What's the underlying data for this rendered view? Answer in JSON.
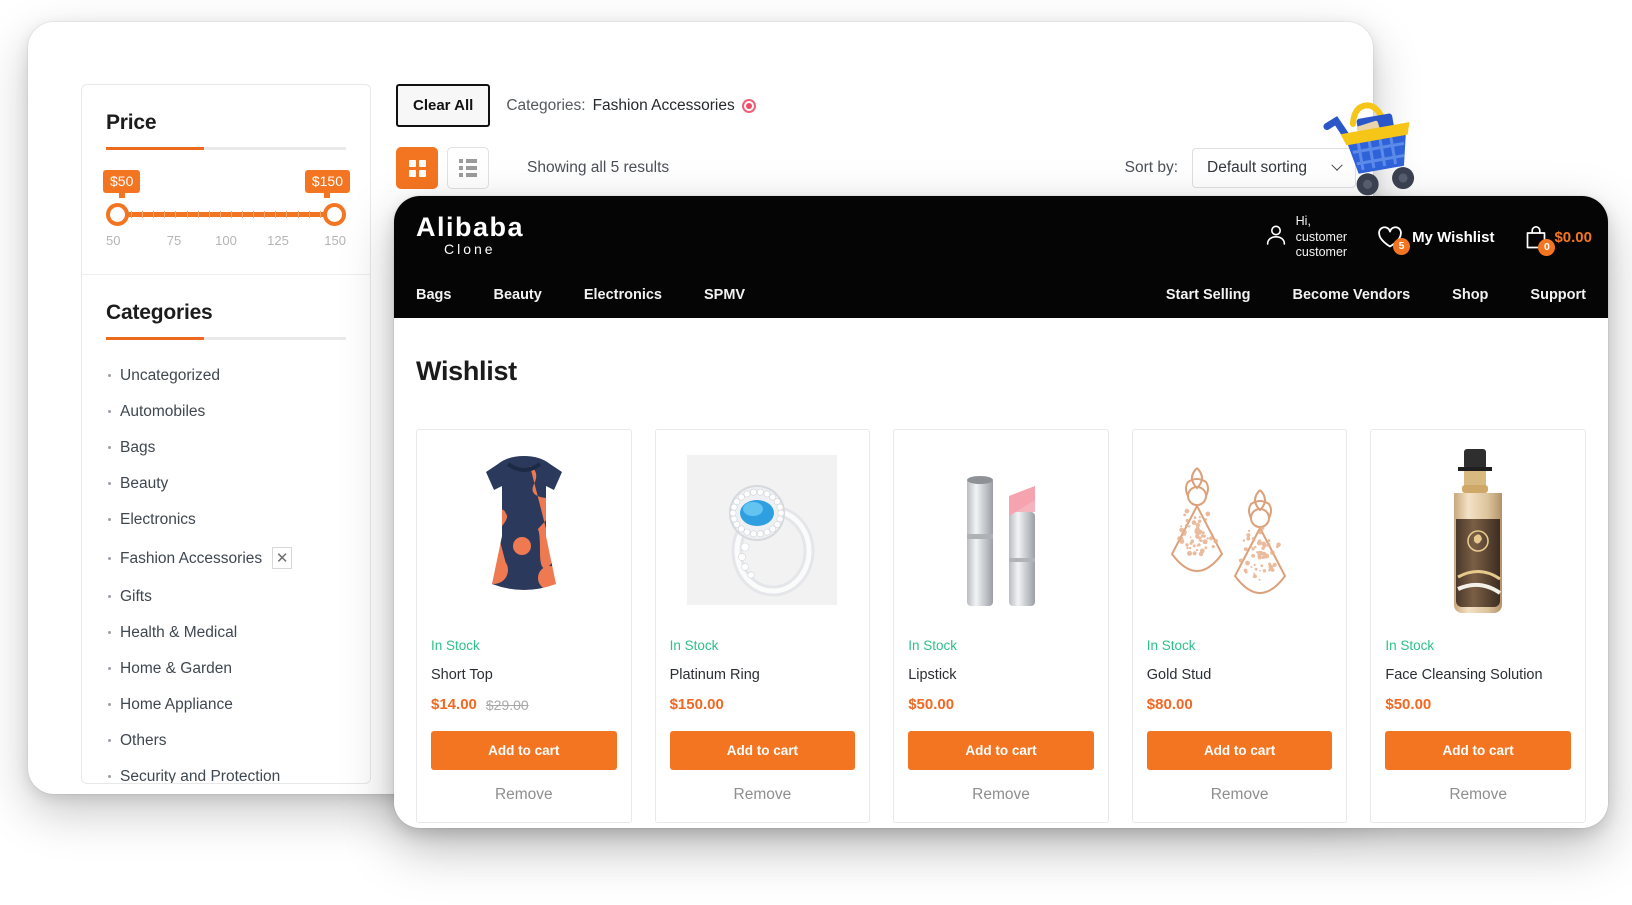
{
  "filters": {
    "price": {
      "title": "Price",
      "min_bubble": "$50",
      "max_bubble": "$150",
      "ticks": [
        "50",
        "75",
        "100",
        "125",
        "150"
      ]
    },
    "categories": {
      "title": "Categories",
      "items": [
        {
          "label": "Uncategorized",
          "active": false
        },
        {
          "label": "Automobiles",
          "active": false
        },
        {
          "label": "Bags",
          "active": false
        },
        {
          "label": "Beauty",
          "active": false
        },
        {
          "label": "Electronics",
          "active": false
        },
        {
          "label": "Fashion Accessories",
          "active": true,
          "remove_icon": "close-icon"
        },
        {
          "label": "Gifts",
          "active": false
        },
        {
          "label": "Health & Medical",
          "active": false
        },
        {
          "label": "Home & Garden",
          "active": false
        },
        {
          "label": "Home Appliance",
          "active": false
        },
        {
          "label": "Others",
          "active": false
        },
        {
          "label": "Security and Protection",
          "active": false
        }
      ]
    }
  },
  "toolbar": {
    "clear_all_label": "Clear All",
    "active_filter_label": "Categories:",
    "active_filter_value": "Fashion Accessories",
    "results_text": "Showing all 5 results",
    "grid_view_icon": "grid-view-icon",
    "list_view_icon": "list-view-icon",
    "sort_label": "Sort by:",
    "sort_value": "Default sorting",
    "sort_options": [
      "Default sorting"
    ]
  },
  "store_header": {
    "logo_main": "Alibaba",
    "logo_sub": "Clone",
    "account_greeting": "Hi,",
    "account_name_line1": "customer",
    "account_name_line2": "customer",
    "wishlist_label": "My Wishlist",
    "wishlist_count": "5",
    "cart_count": "0",
    "cart_total": "$0.00",
    "nav_left": [
      "Bags",
      "Beauty",
      "Electronics",
      "SPMV"
    ],
    "nav_right": [
      "Start Selling",
      "Become Vendors",
      "Shop",
      "Support"
    ]
  },
  "wishlist": {
    "title": "Wishlist",
    "add_to_cart_label": "Add to cart",
    "remove_label": "Remove",
    "products": [
      {
        "name": "Short Top",
        "stock": "In Stock",
        "price": "$14.00",
        "old_price": "$29.00",
        "image": "short-top"
      },
      {
        "name": "Platinum Ring",
        "stock": "In Stock",
        "price": "$150.00",
        "old_price": "",
        "image": "platinum-ring"
      },
      {
        "name": "Lipstick",
        "stock": "In Stock",
        "price": "$50.00",
        "old_price": "",
        "image": "lipstick"
      },
      {
        "name": "Gold Stud",
        "stock": "In Stock",
        "price": "$80.00",
        "old_price": "",
        "image": "gold-stud"
      },
      {
        "name": "Face Cleansing Solution",
        "stock": "In Stock",
        "price": "$50.00",
        "old_price": "",
        "image": "face-cleansing-solution"
      }
    ]
  },
  "decoration": {
    "cart_illustration": "3d-shopping-cart-illustration"
  },
  "colors": {
    "accent_orange": "#f47521",
    "header_black": "#050505",
    "stock_green": "#2fc08a",
    "chip_red": "#ef4b68"
  }
}
